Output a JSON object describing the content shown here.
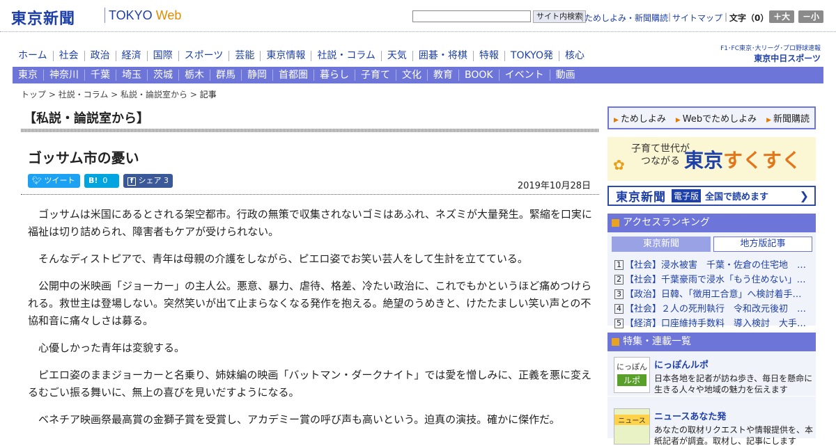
{
  "header": {
    "logo": "東京新聞",
    "logo_sub_a": "TOKYO ",
    "logo_sub_b": "Web",
    "search_button": "サイト内検索",
    "links": [
      "ためしよみ・新聞購読",
      "サイトマップ"
    ],
    "font_label": "文字（0）",
    "font_up": "＋大",
    "font_down": "－小"
  },
  "nav_main": [
    "ホーム",
    "社会",
    "政治",
    "経済",
    "国際",
    "スポーツ",
    "芸能",
    "東京情報",
    "社説・コラム",
    "天気",
    "囲碁・将棋",
    "特報",
    "TOKYO発",
    "核心"
  ],
  "chunichi": {
    "line1": "F1･FC東京･大リーグ･プロ野球速報",
    "line2": "東京中日スポーツ"
  },
  "nav_region": [
    "東京",
    "神奈川",
    "千葉",
    "埼玉",
    "茨城",
    "栃木",
    "群馬",
    "静岡",
    "首都圏",
    "暮らし",
    "子育て",
    "文化",
    "教育",
    "BOOK",
    "イベント",
    "動画"
  ],
  "breadcrumb": {
    "items": [
      "トップ",
      "社説・コラム",
      "私説・論説室から"
    ],
    "current": "記事"
  },
  "article": {
    "section": "【私説・論説室から】",
    "title": "ゴッサム市の憂い",
    "tweet": "ツイート",
    "hatena_count": "0",
    "share": "シェア 3",
    "date": "2019年10月28日",
    "paragraphs": [
      "ゴッサムは米国にあるとされる架空都市。行政の無策で収集されないゴミはあふれ、ネズミが大量発生。緊縮を口実に福祉は切り詰められ、障害者もケアが受けられない。",
      "そんなディストピアで、青年は母親の介護をしながら、ピエロ姿でお笑い芸人をして生計を立てている。",
      "公開中の米映画「ジョーカー」の主人公。悪意、暴力、虐待、格差、冷たい政治に、これでもかというほど痛めつけられる。救世主は登場しない。突然笑いが出て止まらなくなる発作を抱える。絶望のうめきと、けたたましい笑い声との不協和音に痛々しさは募る。",
      "心優しかった青年は変貌する。",
      "ピエロ姿のままジョーカーと名乗り、姉妹編の映画「バットマン・ダークナイト」では愛を憎しみに、正義を悪に変えるむごい振る舞いに、無上の喜びを見いだすようになる。",
      "ベネチア映画祭最高賞の金獅子賞を受賞し、アカデミー賞の呼び声も高いという。迫真の演技。確かに傑作だ。"
    ]
  },
  "sidebar": {
    "links": [
      "ためしよみ",
      "Webでためしよみ",
      "新聞購読"
    ],
    "sukusuku": {
      "line1": "子育て世代が",
      "line2": "つながる",
      "logo_a": "東京",
      "logo_b": "すくすく"
    },
    "digital": {
      "name": "東京新聞",
      "badge": "電子版",
      "text": "全国で読めます"
    },
    "ranking": {
      "title": "アクセスランキング",
      "tab_a": "東京新聞",
      "tab_b": "地方版記事",
      "items": [
        "【社会】浸水被害　千葉・佐倉の住宅地　…",
        "【社会】千葉豪雨で浸水「もう住めない」…",
        "【政治】日韓、「徴用工合意」へ検討着手…",
        "【社会】２人の死刑執行　令和改元後初　…",
        "【経済】口座維持手数料　導入検討　大手…"
      ]
    },
    "features": {
      "title": "特集・連載一覧",
      "items": [
        {
          "icon_a": "にっぽん",
          "icon_b": "ルポ",
          "title": "にっぽんルポ",
          "desc": "日本各地を記者が訪ね歩き、毎日を懸命に生きる人々や地域の魅力を伝えます"
        },
        {
          "icon_a": "ニュース",
          "icon_b": "",
          "title": "ニュースあなた発",
          "desc": "あなたの取材リクエストや情報提供を、本紙記者が調査。取材し、記事にします"
        }
      ]
    }
  }
}
